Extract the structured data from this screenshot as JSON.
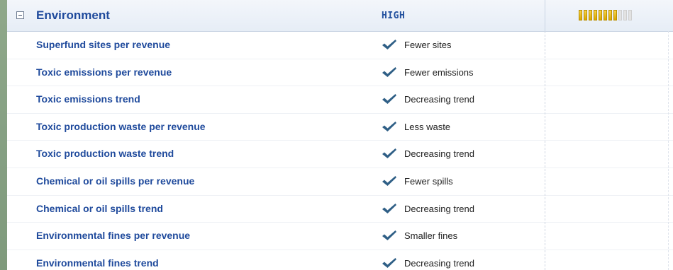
{
  "header": {
    "title": "Environment",
    "rating": "HIGH",
    "meter": {
      "filled": 8,
      "total": 11
    }
  },
  "rows": [
    {
      "label": "Superfund sites per revenue",
      "value": "Fewer sites"
    },
    {
      "label": "Toxic emissions per revenue",
      "value": "Fewer emissions"
    },
    {
      "label": "Toxic emissions trend",
      "value": "Decreasing trend"
    },
    {
      "label": "Toxic production waste per revenue",
      "value": "Less waste"
    },
    {
      "label": "Toxic production waste trend",
      "value": "Decreasing trend"
    },
    {
      "label": "Chemical or oil spills per revenue",
      "value": "Fewer spills"
    },
    {
      "label": "Chemical or oil spills trend",
      "value": "Decreasing trend"
    },
    {
      "label": "Environmental fines per revenue",
      "value": "Smaller fines"
    },
    {
      "label": "Environmental fines trend",
      "value": "Decreasing trend"
    }
  ],
  "colors": {
    "label": "#1f4a9c",
    "check": "#2f5f86",
    "meter_on": "#e2b400",
    "meter_off": "#e2e2e2"
  },
  "icons": {
    "toggle": "minus-square-icon",
    "check": "checkmark-icon"
  }
}
